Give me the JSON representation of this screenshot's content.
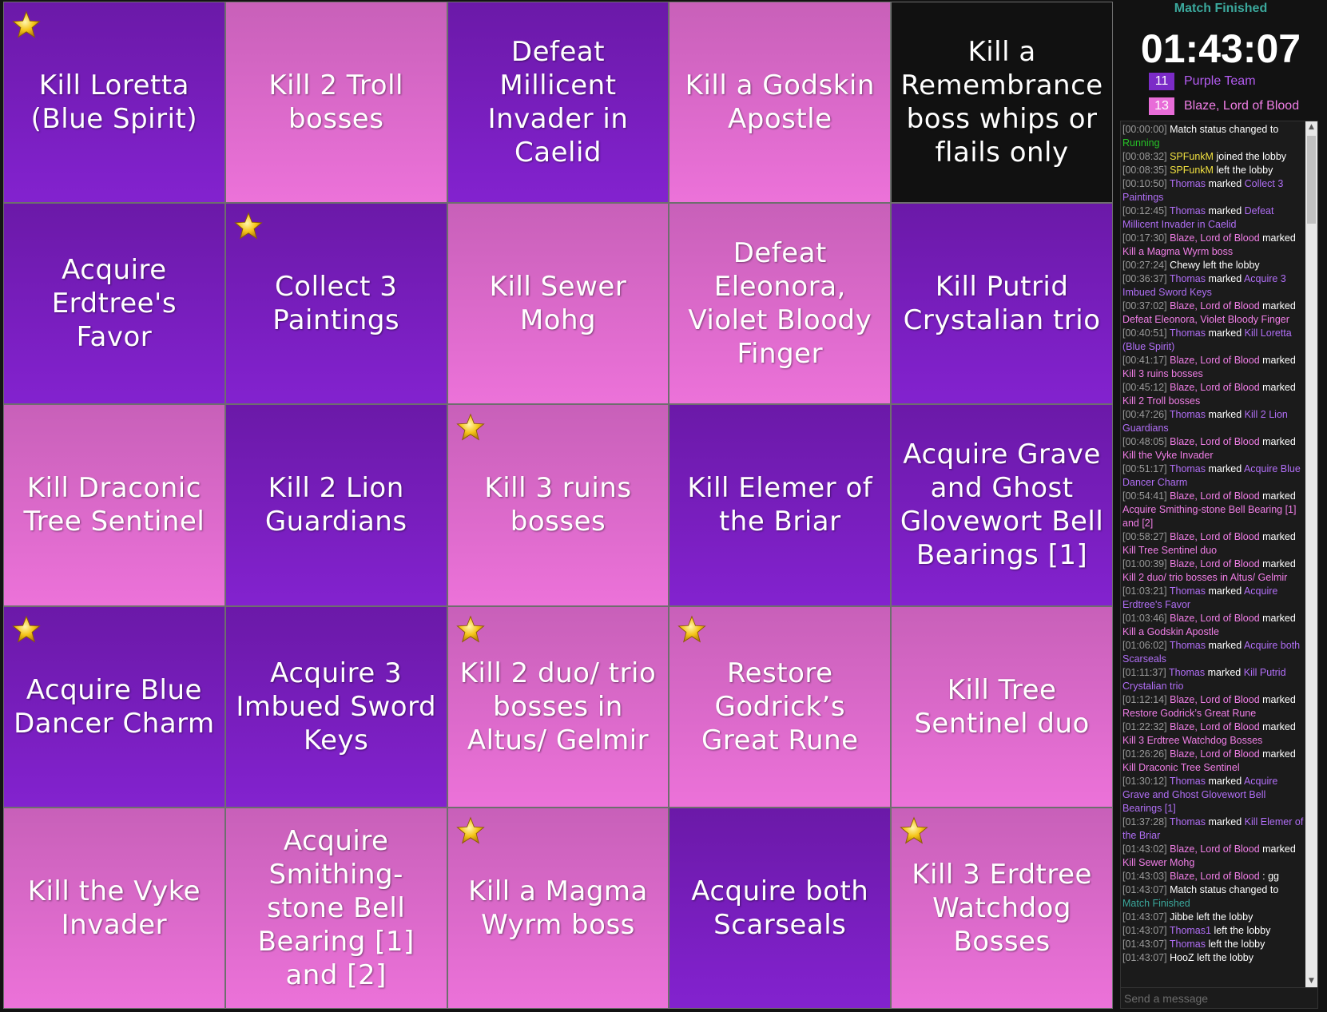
{
  "colors": {
    "purple_team": "#7b2bc7",
    "pink_team": "#e86cd8",
    "purple_text": "#b45cf2",
    "pink_text": "#f07ee6",
    "status_green": "#3ba89c",
    "running_green": "#27c227",
    "user_yellow": "#f0e040",
    "user_violet": "#b06ef5"
  },
  "board": {
    "cells": [
      {
        "label": "Kill Loretta (Blue Spirit)",
        "color": "purple",
        "starred": true
      },
      {
        "label": "Kill 2 Troll bosses",
        "color": "pink",
        "starred": false
      },
      {
        "label": "Defeat Millicent Invader in Caelid",
        "color": "purple",
        "starred": false
      },
      {
        "label": "Kill a Godskin Apostle",
        "color": "pink",
        "starred": false
      },
      {
        "label": "Kill a Remembrance boss whips or flails only",
        "color": "black",
        "starred": false
      },
      {
        "label": "Acquire Erdtree's Favor",
        "color": "purple",
        "starred": false
      },
      {
        "label": "Collect 3 Paintings",
        "color": "purple",
        "starred": true
      },
      {
        "label": "Kill Sewer Mohg",
        "color": "pink",
        "starred": false
      },
      {
        "label": "Defeat Eleonora, Violet Bloody Finger",
        "color": "pink",
        "starred": false
      },
      {
        "label": "Kill Putrid Crystalian trio",
        "color": "purple",
        "starred": false
      },
      {
        "label": "Kill Draconic Tree Sentinel",
        "color": "pink",
        "starred": false
      },
      {
        "label": "Kill 2 Lion Guardians",
        "color": "purple",
        "starred": false
      },
      {
        "label": "Kill 3 ruins bosses",
        "color": "pink",
        "starred": true
      },
      {
        "label": "Kill Elemer of the Briar",
        "color": "purple",
        "starred": false
      },
      {
        "label": "Acquire Grave and Ghost Glovewort Bell Bearings [1]",
        "color": "purple",
        "starred": false
      },
      {
        "label": "Acquire Blue Dancer Charm",
        "color": "purple",
        "starred": true
      },
      {
        "label": "Acquire 3 Imbued Sword Keys",
        "color": "purple",
        "starred": false
      },
      {
        "label": "Kill 2 duo/ trio bosses in Altus/ Gelmir",
        "color": "pink",
        "starred": true
      },
      {
        "label": "Restore Godrick’s Great Rune",
        "color": "pink",
        "starred": true
      },
      {
        "label": "Kill Tree Sentinel duo",
        "color": "pink",
        "starred": false
      },
      {
        "label": "Kill the Vyke Invader",
        "color": "pink",
        "starred": false
      },
      {
        "label": "Acquire Smithing-stone Bell Bearing [1] and [2]",
        "color": "pink",
        "starred": false
      },
      {
        "label": "Kill a Magma Wyrm boss",
        "color": "pink",
        "starred": true
      },
      {
        "label": "Acquire both Scarseals",
        "color": "purple",
        "starred": false
      },
      {
        "label": "Kill 3 Erdtree Watchdog Bosses",
        "color": "pink",
        "starred": true
      }
    ]
  },
  "sidebar": {
    "status": "Match Finished",
    "timer": "01:43:07",
    "teams": [
      {
        "score": "11",
        "name": "Purple Team",
        "color": "#7b2bc7",
        "text_color": "#b45cf2"
      },
      {
        "score": "13",
        "name": "Blaze, Lord of Blood",
        "color": "#e86cd8",
        "text_color": "#f07ee6"
      }
    ],
    "message_placeholder": "Send a message"
  },
  "log": [
    {
      "ts": "[00:00:00]",
      "parts": [
        {
          "t": " Match status changed to "
        },
        {
          "t": "Running",
          "c": "#27c227"
        }
      ]
    },
    {
      "ts": "[00:08:32]",
      "parts": [
        {
          "t": " "
        },
        {
          "t": "SPFunkM",
          "c": "#f0e040"
        },
        {
          "t": " joined the lobby"
        }
      ]
    },
    {
      "ts": "[00:08:35]",
      "parts": [
        {
          "t": " "
        },
        {
          "t": "SPFunkM",
          "c": "#f0e040"
        },
        {
          "t": " left the lobby"
        }
      ]
    },
    {
      "ts": "[00:10:50]",
      "parts": [
        {
          "t": " "
        },
        {
          "t": "Thomas",
          "c": "#b06ef5"
        },
        {
          "t": " marked "
        },
        {
          "t": "Collect 3 Paintings",
          "c": "#b06ef5"
        }
      ]
    },
    {
      "ts": "[00:12:45]",
      "parts": [
        {
          "t": " "
        },
        {
          "t": "Thomas",
          "c": "#b06ef5"
        },
        {
          "t": " marked "
        },
        {
          "t": "Defeat Millicent Invader in Caelid",
          "c": "#b06ef5"
        }
      ]
    },
    {
      "ts": "[00:17:30]",
      "parts": [
        {
          "t": " "
        },
        {
          "t": "Blaze, Lord of Blood",
          "c": "#f07ee6"
        },
        {
          "t": " marked "
        },
        {
          "t": "Kill a Magma Wyrm boss",
          "c": "#f07ee6"
        }
      ]
    },
    {
      "ts": "[00:27:24]",
      "parts": [
        {
          "t": " Chewy left the lobby"
        }
      ]
    },
    {
      "ts": "[00:36:37]",
      "parts": [
        {
          "t": " "
        },
        {
          "t": "Thomas",
          "c": "#b06ef5"
        },
        {
          "t": " marked "
        },
        {
          "t": "Acquire 3 Imbued Sword Keys",
          "c": "#b06ef5"
        }
      ]
    },
    {
      "ts": "[00:37:02]",
      "parts": [
        {
          "t": " "
        },
        {
          "t": "Blaze, Lord of Blood",
          "c": "#f07ee6"
        },
        {
          "t": " marked "
        },
        {
          "t": "Defeat Eleonora, Violet Bloody Finger",
          "c": "#f07ee6"
        }
      ]
    },
    {
      "ts": "[00:40:51]",
      "parts": [
        {
          "t": " "
        },
        {
          "t": "Thomas",
          "c": "#b06ef5"
        },
        {
          "t": " marked "
        },
        {
          "t": "Kill Loretta (Blue Spirit)",
          "c": "#b06ef5"
        }
      ]
    },
    {
      "ts": "[00:41:17]",
      "parts": [
        {
          "t": " "
        },
        {
          "t": "Blaze, Lord of Blood",
          "c": "#f07ee6"
        },
        {
          "t": " marked "
        },
        {
          "t": "Kill 3 ruins bosses",
          "c": "#f07ee6"
        }
      ]
    },
    {
      "ts": "[00:45:12]",
      "parts": [
        {
          "t": " "
        },
        {
          "t": "Blaze, Lord of Blood",
          "c": "#f07ee6"
        },
        {
          "t": " marked "
        },
        {
          "t": "Kill 2 Troll bosses",
          "c": "#f07ee6"
        }
      ]
    },
    {
      "ts": "[00:47:26]",
      "parts": [
        {
          "t": " "
        },
        {
          "t": "Thomas",
          "c": "#b06ef5"
        },
        {
          "t": " marked "
        },
        {
          "t": "Kill 2 Lion Guardians",
          "c": "#b06ef5"
        }
      ]
    },
    {
      "ts": "[00:48:05]",
      "parts": [
        {
          "t": " "
        },
        {
          "t": "Blaze, Lord of Blood",
          "c": "#f07ee6"
        },
        {
          "t": " marked "
        },
        {
          "t": "Kill the Vyke Invader",
          "c": "#f07ee6"
        }
      ]
    },
    {
      "ts": "[00:51:17]",
      "parts": [
        {
          "t": " "
        },
        {
          "t": "Thomas",
          "c": "#b06ef5"
        },
        {
          "t": " marked "
        },
        {
          "t": "Acquire Blue Dancer Charm",
          "c": "#b06ef5"
        }
      ]
    },
    {
      "ts": "[00:54:41]",
      "parts": [
        {
          "t": " "
        },
        {
          "t": "Blaze, Lord of Blood",
          "c": "#f07ee6"
        },
        {
          "t": " marked "
        },
        {
          "t": "Acquire Smithing-stone Bell Bearing [1] and [2]",
          "c": "#f07ee6"
        }
      ]
    },
    {
      "ts": "[00:58:27]",
      "parts": [
        {
          "t": " "
        },
        {
          "t": "Blaze, Lord of Blood",
          "c": "#f07ee6"
        },
        {
          "t": " marked "
        },
        {
          "t": "Kill Tree Sentinel duo",
          "c": "#f07ee6"
        }
      ]
    },
    {
      "ts": "[01:00:39]",
      "parts": [
        {
          "t": " "
        },
        {
          "t": "Blaze, Lord of Blood",
          "c": "#f07ee6"
        },
        {
          "t": " marked "
        },
        {
          "t": "Kill 2 duo/ trio bosses in Altus/ Gelmir",
          "c": "#f07ee6"
        }
      ]
    },
    {
      "ts": "[01:03:21]",
      "parts": [
        {
          "t": " "
        },
        {
          "t": "Thomas",
          "c": "#b06ef5"
        },
        {
          "t": " marked "
        },
        {
          "t": "Acquire Erdtree's Favor",
          "c": "#b06ef5"
        }
      ]
    },
    {
      "ts": "[01:03:46]",
      "parts": [
        {
          "t": " "
        },
        {
          "t": "Blaze, Lord of Blood",
          "c": "#f07ee6"
        },
        {
          "t": " marked "
        },
        {
          "t": "Kill a Godskin Apostle",
          "c": "#f07ee6"
        }
      ]
    },
    {
      "ts": "[01:06:02]",
      "parts": [
        {
          "t": " "
        },
        {
          "t": "Thomas",
          "c": "#b06ef5"
        },
        {
          "t": " marked "
        },
        {
          "t": "Acquire both Scarseals",
          "c": "#b06ef5"
        }
      ]
    },
    {
      "ts": "[01:11:37]",
      "parts": [
        {
          "t": " "
        },
        {
          "t": "Thomas",
          "c": "#b06ef5"
        },
        {
          "t": " marked "
        },
        {
          "t": "Kill Putrid Crystalian trio",
          "c": "#b06ef5"
        }
      ]
    },
    {
      "ts": "[01:12:14]",
      "parts": [
        {
          "t": " "
        },
        {
          "t": "Blaze, Lord of Blood",
          "c": "#f07ee6"
        },
        {
          "t": " marked "
        },
        {
          "t": "Restore Godrick’s Great Rune",
          "c": "#f07ee6"
        }
      ]
    },
    {
      "ts": "[01:22:32]",
      "parts": [
        {
          "t": " "
        },
        {
          "t": "Blaze, Lord of Blood",
          "c": "#f07ee6"
        },
        {
          "t": " marked "
        },
        {
          "t": "Kill 3 Erdtree Watchdog Bosses",
          "c": "#f07ee6"
        }
      ]
    },
    {
      "ts": "[01:26:26]",
      "parts": [
        {
          "t": " "
        },
        {
          "t": "Blaze, Lord of Blood",
          "c": "#f07ee6"
        },
        {
          "t": " marked "
        },
        {
          "t": "Kill Draconic Tree Sentinel",
          "c": "#f07ee6"
        }
      ]
    },
    {
      "ts": "[01:30:12]",
      "parts": [
        {
          "t": " "
        },
        {
          "t": "Thomas",
          "c": "#b06ef5"
        },
        {
          "t": " marked "
        },
        {
          "t": "Acquire Grave and Ghost Glovewort Bell Bearings [1]",
          "c": "#b06ef5"
        }
      ]
    },
    {
      "ts": "[01:37:28]",
      "parts": [
        {
          "t": " "
        },
        {
          "t": "Thomas",
          "c": "#b06ef5"
        },
        {
          "t": " marked "
        },
        {
          "t": "Kill Elemer of the Briar",
          "c": "#b06ef5"
        }
      ]
    },
    {
      "ts": "[01:43:02]",
      "parts": [
        {
          "t": " "
        },
        {
          "t": "Blaze, Lord of Blood",
          "c": "#f07ee6"
        },
        {
          "t": " marked "
        },
        {
          "t": "Kill Sewer Mohg",
          "c": "#f07ee6"
        }
      ]
    },
    {
      "ts": "[01:43:03]",
      "parts": [
        {
          "t": " "
        },
        {
          "t": "Blaze, Lord of Blood",
          "c": "#f07ee6"
        },
        {
          "t": " : gg"
        }
      ]
    },
    {
      "ts": "[01:43:07]",
      "parts": [
        {
          "t": " Match status changed to "
        },
        {
          "t": "Match Finished",
          "c": "#3ba89c"
        }
      ]
    },
    {
      "ts": "[01:43:07]",
      "parts": [
        {
          "t": " Jibbe left the lobby"
        }
      ]
    },
    {
      "ts": "[01:43:07]",
      "parts": [
        {
          "t": " "
        },
        {
          "t": "Thomas1",
          "c": "#b06ef5"
        },
        {
          "t": " left the lobby"
        }
      ]
    },
    {
      "ts": "[01:43:07]",
      "parts": [
        {
          "t": " "
        },
        {
          "t": "Thomas",
          "c": "#b06ef5"
        },
        {
          "t": " left the lobby"
        }
      ]
    },
    {
      "ts": "[01:43:07]",
      "parts": [
        {
          "t": " HooZ left the lobby"
        }
      ]
    }
  ]
}
